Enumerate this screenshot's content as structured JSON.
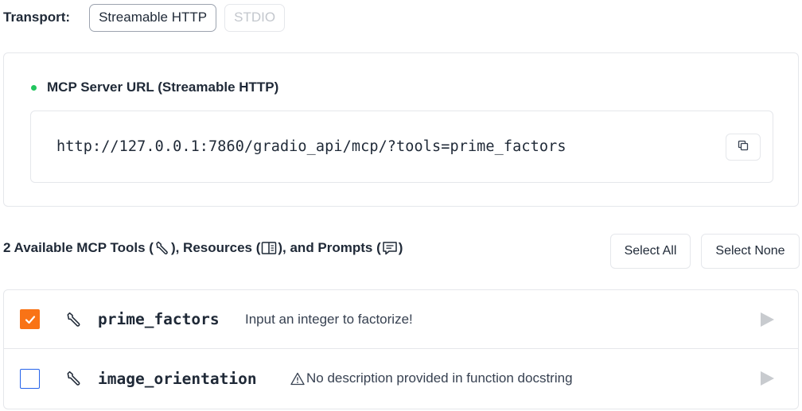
{
  "transport": {
    "label": "Transport:",
    "options": [
      {
        "label": "Streamable HTTP",
        "active": true
      },
      {
        "label": "STDIO",
        "active": false
      }
    ]
  },
  "server": {
    "title": "MCP Server URL (Streamable HTTP)",
    "status_color": "#22c55e",
    "url": "http://127.0.0.1:7860/gradio_api/mcp/?tools=prime_factors",
    "copy_icon": "copy-icon"
  },
  "tools_header": {
    "part1": "2 Available MCP Tools (",
    "part2": "), Resources (",
    "part3": "), and Prompts (",
    "part4": ")",
    "icons": [
      "wrench-icon",
      "resource-icon",
      "prompt-icon"
    ]
  },
  "actions": {
    "select_all": "Select All",
    "select_none": "Select None"
  },
  "tools": [
    {
      "name": "prime_factors",
      "description": "Input an integer to factorize!",
      "checked": true,
      "warning": false
    },
    {
      "name": "image_orientation",
      "description": "No description provided in function docstring",
      "checked": false,
      "warning": true
    }
  ],
  "colors": {
    "accent": "#f97316",
    "checkbox_border": "#2563eb",
    "border": "#e5e7eb"
  }
}
